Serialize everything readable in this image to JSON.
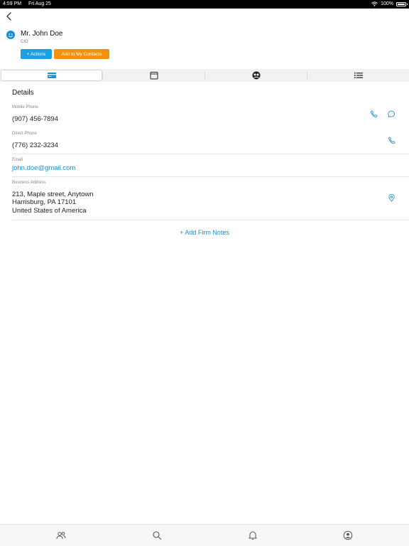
{
  "status_bar": {
    "time": "4:59 PM",
    "date": "Fri Aug 25",
    "battery": "100%"
  },
  "contact": {
    "name": "Mr. John Doe",
    "title": "CIO"
  },
  "buttons": {
    "actions": "+ Actions",
    "add_contact": "Add to My Contacts"
  },
  "tabs": [
    {
      "icon": "contact-card-icon",
      "active": true
    },
    {
      "icon": "calendar-icon",
      "active": false
    },
    {
      "icon": "people-icon",
      "active": false
    },
    {
      "icon": "list-icon",
      "active": false
    }
  ],
  "details": {
    "heading": "Details",
    "mobile_label": "Mobile Phone",
    "mobile_value": "(907) 456-7894",
    "direct_label": "Direct Phone",
    "direct_value": "(776) 232-3234",
    "email_label": "Email",
    "email_value": "john.doe@gmail.com",
    "address_label": "Business Address",
    "address_line1": "213, Maple street, Anytown",
    "address_line2": "Harrisburg, PA 17101",
    "address_line3": "United States of America"
  },
  "notes_link": "+ Add Firm Notes",
  "bottom_nav": [
    "contacts-icon",
    "search-icon",
    "bell-icon",
    "profile-icon"
  ],
  "colors": {
    "accent": "#1a8fd0",
    "actions_button": "#1ba1e2",
    "add_button": "#f5910d"
  }
}
